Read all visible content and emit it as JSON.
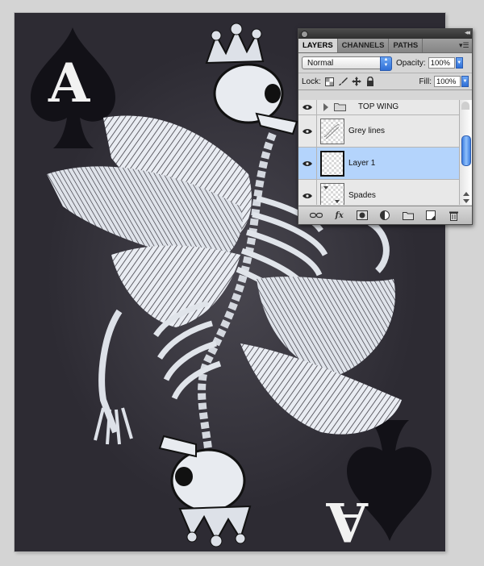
{
  "canvas": {
    "background": "#2d2b33",
    "rank_letter": "A",
    "suit": "spade"
  },
  "layers_panel": {
    "tabs": [
      {
        "label": "LAYERS",
        "active": true
      },
      {
        "label": "CHANNELS",
        "active": false
      },
      {
        "label": "PATHS",
        "active": false
      }
    ],
    "blend_mode": "Normal",
    "opacity_label": "Opacity:",
    "opacity_value": "100%",
    "lock_label": "Lock:",
    "fill_label": "Fill:",
    "fill_value": "100%",
    "layers": [
      {
        "name": "TOP WING",
        "type": "group",
        "visible": true
      },
      {
        "name": "Grey lines",
        "type": "layer",
        "visible": true
      },
      {
        "name": "Layer 1",
        "type": "layer",
        "visible": true,
        "selected": true
      },
      {
        "name": "Spades",
        "type": "layer",
        "visible": true
      }
    ],
    "selected_color": "#b4d4fc",
    "accent_color": "#2f6fd6"
  }
}
